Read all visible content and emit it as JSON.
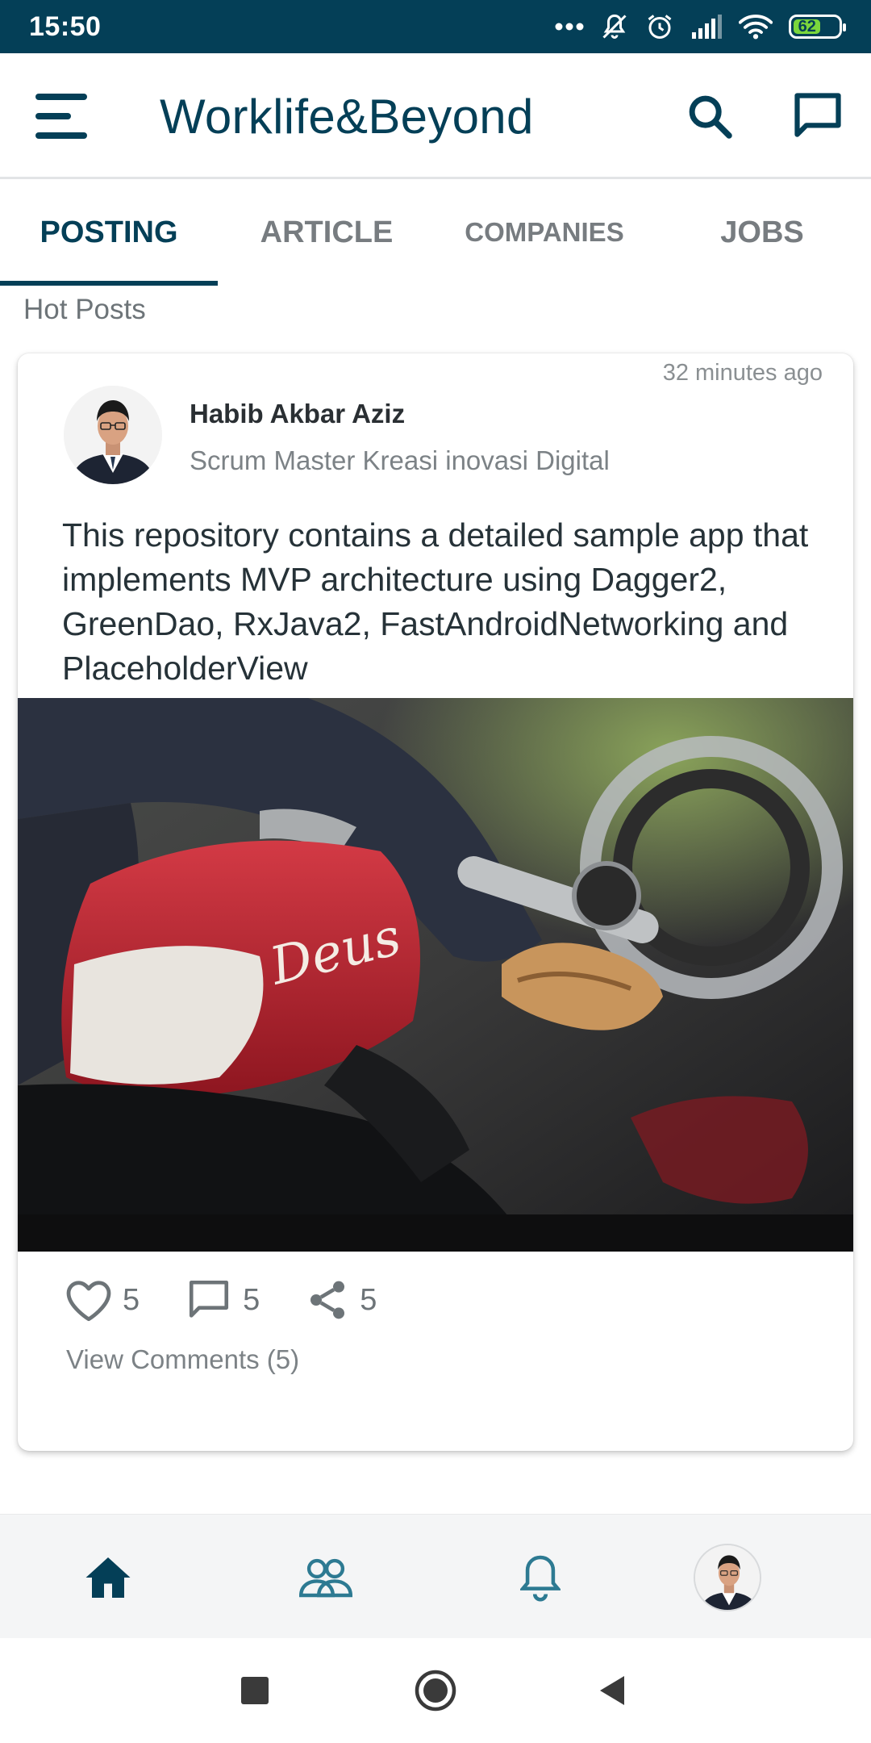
{
  "status_bar": {
    "time": "15:50",
    "battery": "62",
    "icons": [
      "more-dots-icon",
      "silent-bell-icon",
      "alarm-icon",
      "signal-icon",
      "wifi-icon",
      "battery-icon"
    ]
  },
  "app_bar": {
    "title": "Worklife&Beyond",
    "icons": [
      "menu-icon",
      "search-icon",
      "chat-icon"
    ]
  },
  "tabs": [
    {
      "label": "POSTING",
      "active": true
    },
    {
      "label": "ARTICLE",
      "active": false
    },
    {
      "label": "COMPANIES",
      "active": false
    },
    {
      "label": "JOBS",
      "active": false
    }
  ],
  "section_label": "Hot Posts",
  "post": {
    "timestamp": "32 minutes ago",
    "author_name": "Habib Akbar Aziz",
    "author_role": "Scrum Master Kreasi inovasi Digital",
    "body": "This repository contains a detailed sample app that implements MVP architecture using Dagger2, GreenDao, RxJava2, FastAndroidNetworking and PlaceholderView",
    "image_text": "Deus",
    "likes": "5",
    "comments": "5",
    "shares": "5",
    "view_comments": "View Comments (5)"
  },
  "bottom_nav": [
    "home-icon",
    "people-icon",
    "bell-icon",
    "profile-avatar"
  ],
  "colors": {
    "primary": "#043f57",
    "status_bar": "#043f57",
    "battery": "#7bd63c",
    "muted_text": "#7c8286"
  }
}
